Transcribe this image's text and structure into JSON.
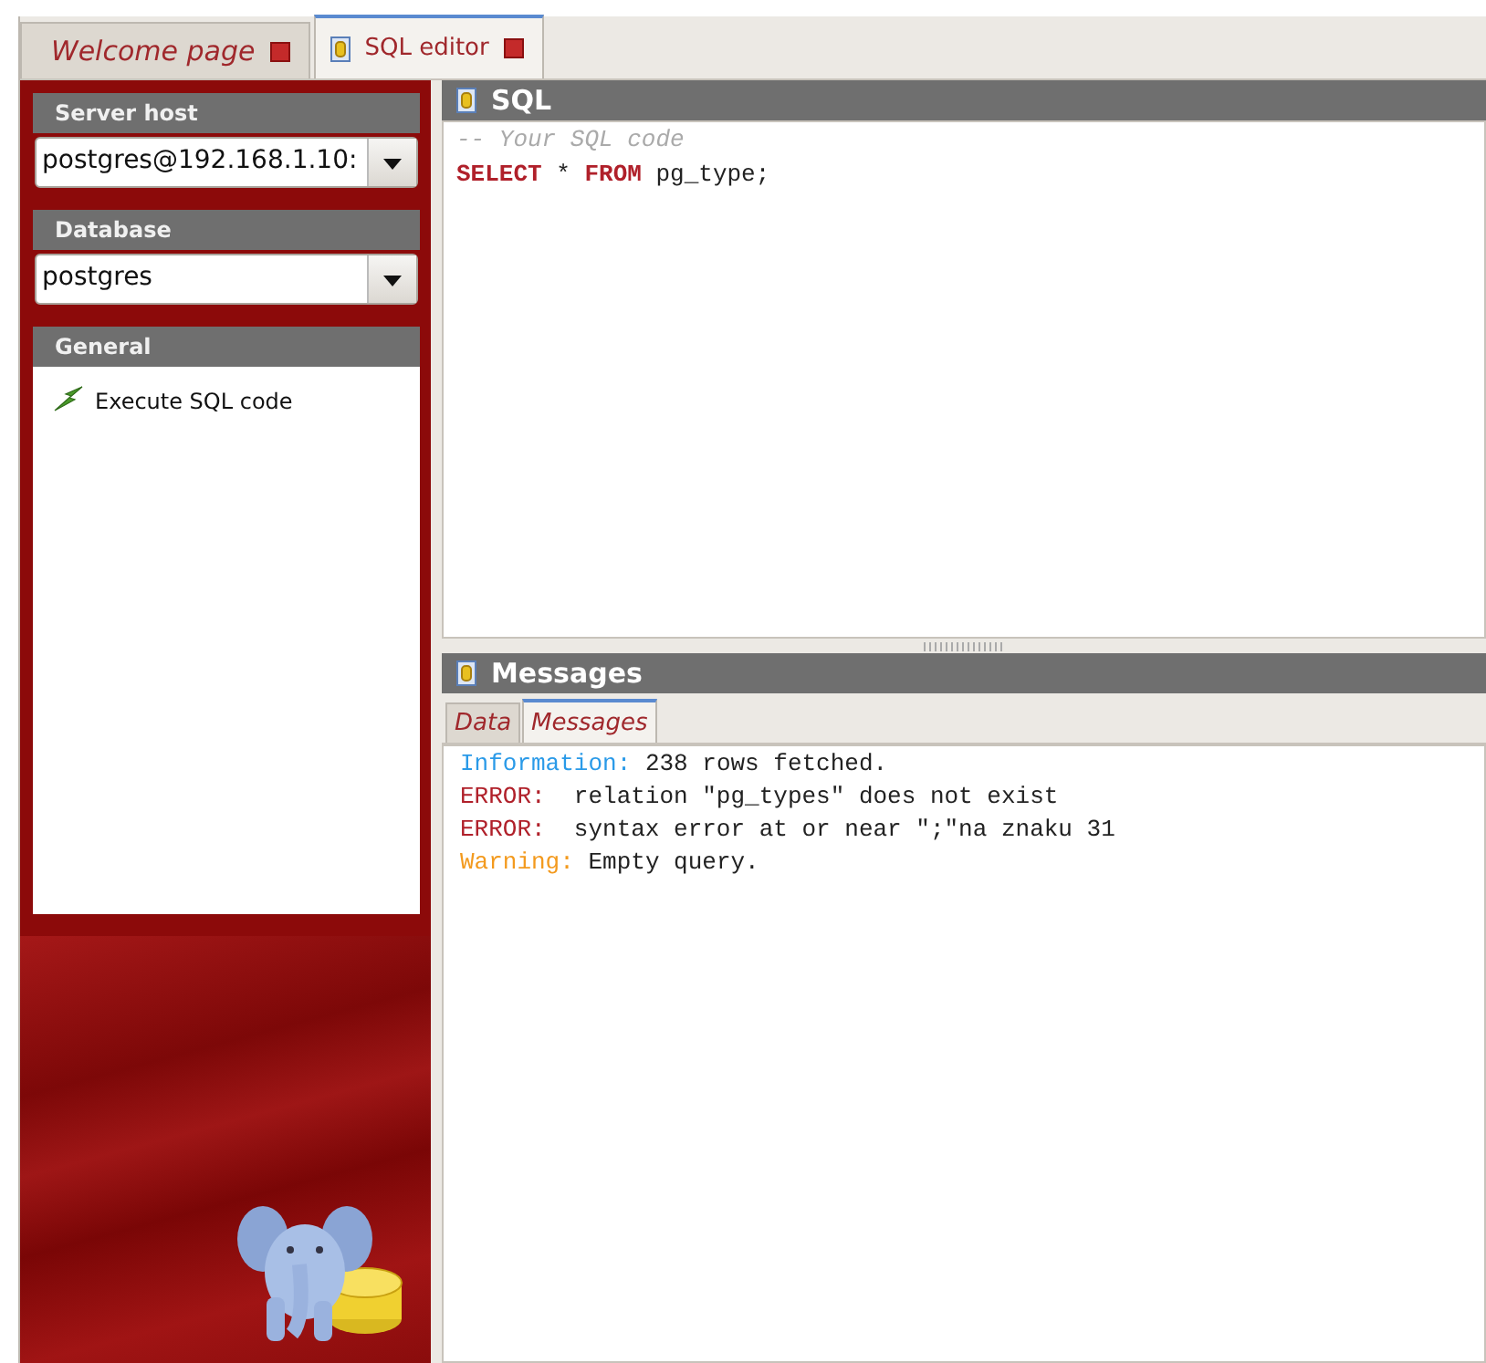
{
  "tabs": [
    {
      "label": "Welcome page",
      "selected": false,
      "icon": false
    },
    {
      "label": "SQL editor",
      "selected": true,
      "icon": true
    }
  ],
  "sidebar": {
    "sections": [
      {
        "kind": "dropdown",
        "title": "Server host",
        "value": "postgres@192.168.1.10:"
      },
      {
        "kind": "dropdown",
        "title": "Database",
        "value": "postgres"
      },
      {
        "kind": "actions",
        "title": "General",
        "items": [
          {
            "label": "Execute SQL code"
          }
        ]
      }
    ]
  },
  "sql_panel": {
    "title": "SQL",
    "lines": [
      [
        {
          "kind": "comment",
          "text": "-- Your SQL code"
        }
      ],
      [
        {
          "kind": "keyword",
          "text": "SELECT"
        },
        {
          "kind": "plain",
          "text": " * "
        },
        {
          "kind": "keyword",
          "text": "FROM"
        },
        {
          "kind": "plain",
          "text": " pg_type;"
        }
      ]
    ]
  },
  "messages_panel": {
    "title": "Messages",
    "tabs": [
      {
        "label": "Data",
        "selected": false
      },
      {
        "label": "Messages",
        "selected": true
      }
    ],
    "messages": [
      {
        "kind": "info",
        "prefix": "Information:",
        "text": "238 rows fetched."
      },
      {
        "kind": "error",
        "prefix": "ERROR:",
        "text": "relation \"pg_types\" does not exist"
      },
      {
        "kind": "error",
        "prefix": "ERROR:",
        "text": "syntax error at or near \";\"na znaku 31"
      },
      {
        "kind": "warning",
        "prefix": "Warning:",
        "text": "Empty query."
      }
    ]
  }
}
